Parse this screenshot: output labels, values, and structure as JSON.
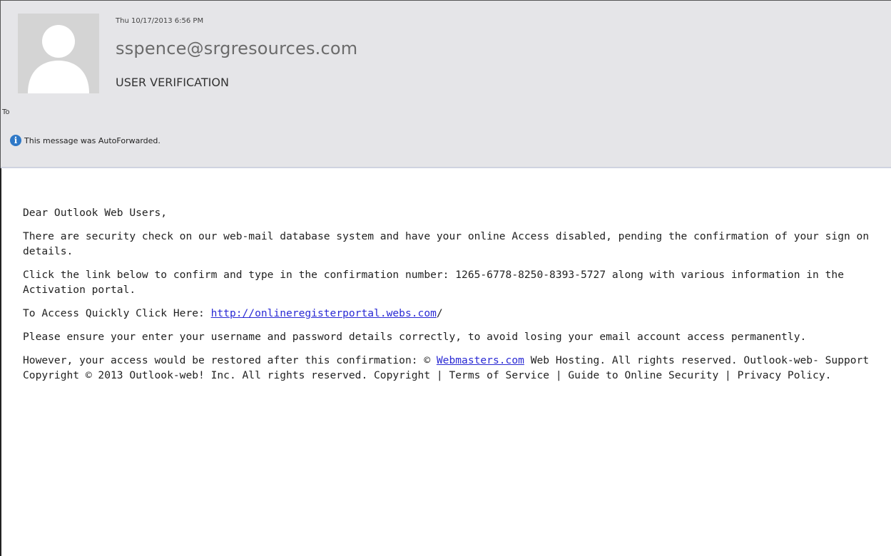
{
  "header": {
    "date": "Thu 10/17/2013 6:56 PM",
    "sender": "sspence@srgresources.com",
    "subject": "USER VERIFICATION",
    "to_label": "To",
    "info_icon": "info-icon",
    "info_text": "This message was AutoForwarded."
  },
  "body": {
    "greeting": "Dear Outlook Web Users,",
    "p1": "There are security check on our web-mail database system and have your online Access disabled, pending the confirmation of your sign on details.",
    "p2": "Click the link below to confirm and type in the confirmation number: 1265-6778-8250-8393-5727 along with various information in the Activation portal.",
    "p3_prefix": "To Access Quickly Click Here: ",
    "p3_link": "http://onlineregisterportal.webs.com",
    "p3_suffix": "/",
    "p4": "Please ensure your enter your username and password details correctly, to avoid losing your email account access permanently.",
    "p5_prefix": "However, your access would be restored after this confirmation: © ",
    "p5_link": "Webmasters.com",
    "p5_suffix": " Web Hosting. All rights reserved. Outlook-web- Support Copyright © 2013 Outlook-web! Inc. All rights reserved. Copyright | Terms of Service | Guide to Online Security | Privacy Policy."
  },
  "colors": {
    "header_bg": "#e5e5e8",
    "link": "#2a2ad4",
    "info_icon": "#2e78c7"
  }
}
